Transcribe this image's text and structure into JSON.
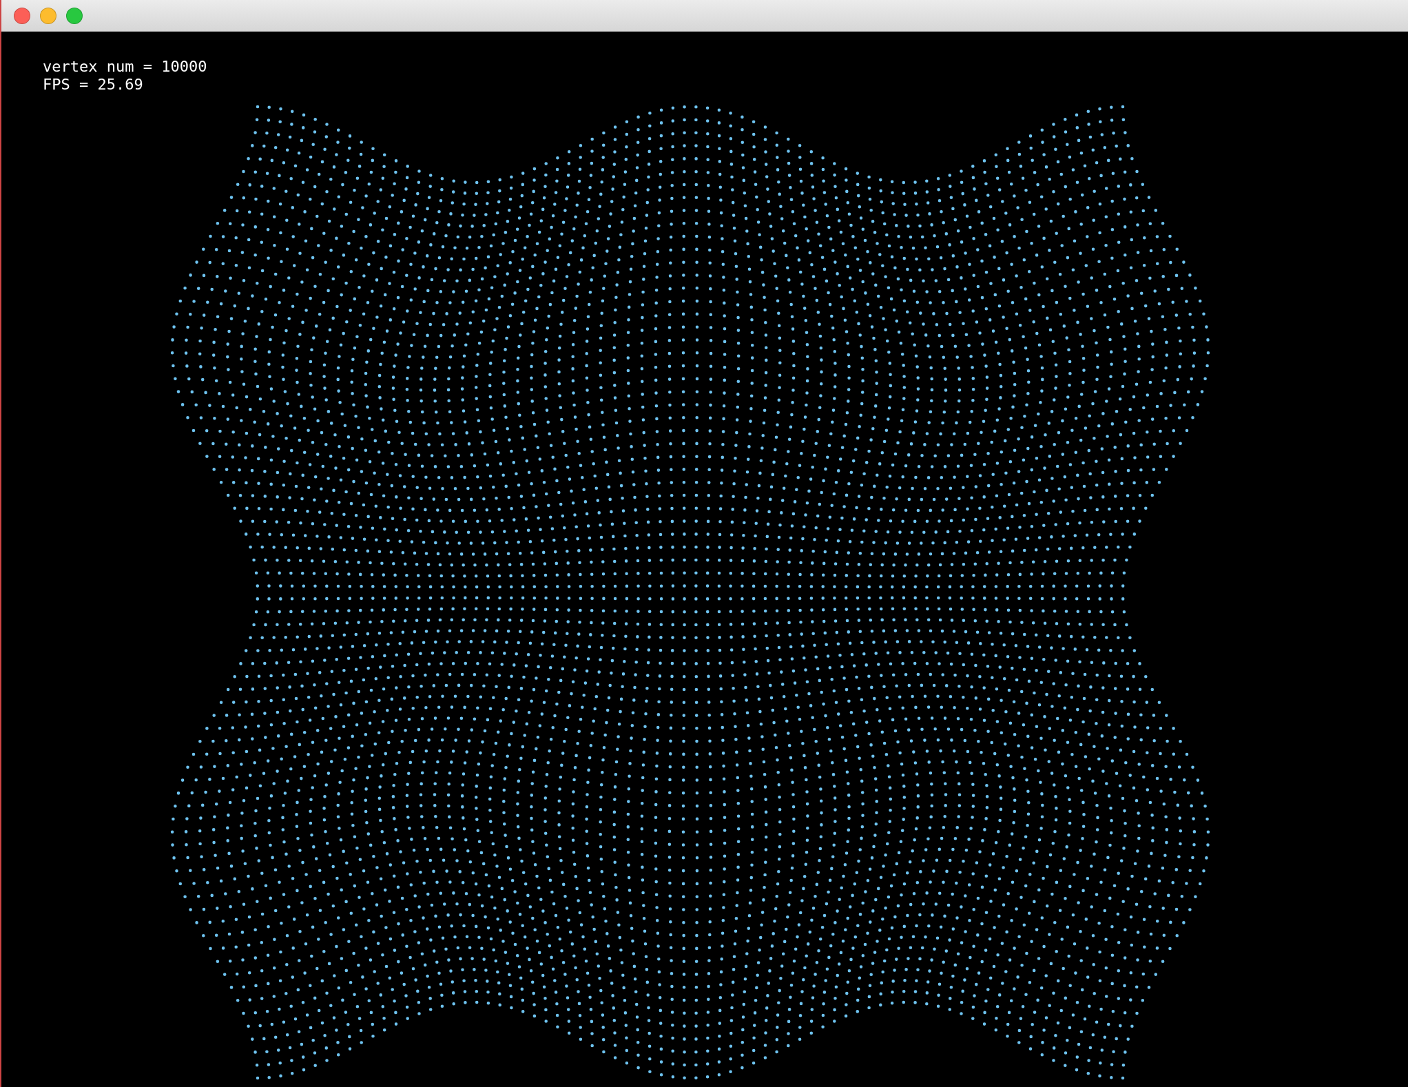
{
  "window": {
    "stats_lines": [
      "vertex num = 10000",
      "FPS = 25.69"
    ]
  }
}
